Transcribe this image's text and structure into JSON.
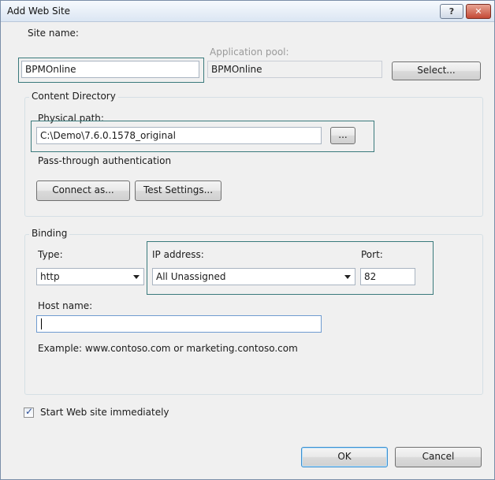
{
  "window": {
    "title": "Add Web Site",
    "help_label": "?",
    "close_label": "✕"
  },
  "site": {
    "name_label": "Site name:",
    "name_value": "BPMOnline",
    "pool_label": "Application pool:",
    "pool_value": "BPMOnline",
    "select_label": "Select..."
  },
  "content": {
    "group_label": "Content Directory",
    "path_label": "Physical path:",
    "path_value": "C:\\Demo\\7.6.0.1578_original",
    "browse_label": "...",
    "auth_label": "Pass-through authentication",
    "connect_label": "Connect as...",
    "test_label": "Test Settings..."
  },
  "binding": {
    "group_label": "Binding",
    "type_label": "Type:",
    "type_value": "http",
    "ip_label": "IP address:",
    "ip_value": "All Unassigned",
    "port_label": "Port:",
    "port_value": "82",
    "host_label": "Host name:",
    "host_value": "",
    "example_text": "Example: www.contoso.com or marketing.contoso.com"
  },
  "start": {
    "checked": true,
    "label": "Start Web site immediately"
  },
  "footer": {
    "ok_label": "OK",
    "cancel_label": "Cancel"
  },
  "colors": {
    "highlight": "#3a7a7c",
    "title_bar": "#dbe6f3",
    "close_button": "#c44a36"
  }
}
